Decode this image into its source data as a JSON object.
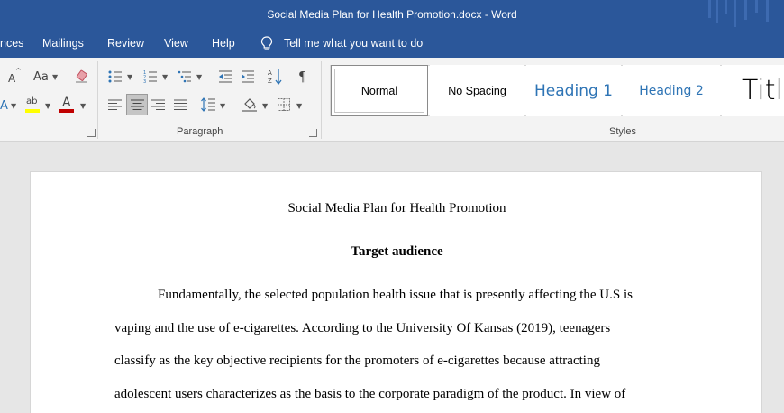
{
  "window": {
    "title": "Social Media Plan for Health Promotion.docx  -  Word"
  },
  "menu": {
    "items": [
      "nces",
      "Mailings",
      "Review",
      "View",
      "Help"
    ],
    "tell_me": "Tell me what you want to do"
  },
  "ribbon": {
    "font_group": {
      "grow_font": "A",
      "change_case": "Aa",
      "font_color_letter": "A",
      "highlight_text": "ab"
    },
    "paragraph_label": "Paragraph",
    "styles_label": "Styles",
    "styles": [
      {
        "label": "Normal",
        "selected": true
      },
      {
        "label": "No Spacing",
        "selected": false
      },
      {
        "label": "Heading 1",
        "selected": false
      },
      {
        "label": "Heading 2",
        "selected": false
      },
      {
        "label": "Title",
        "selected": false
      }
    ],
    "colors": {
      "highlight": "#ffff00",
      "font_color": "#c00000",
      "heading": "#2e74b5",
      "selected_align_bg": "#c5c5c5"
    },
    "icons": [
      "bullets-icon",
      "numbering-icon",
      "multilevel-list-icon",
      "decrease-indent-icon",
      "increase-indent-icon",
      "sort-icon",
      "show-formatting-icon",
      "align-left-icon",
      "align-center-icon",
      "align-right-icon",
      "justify-icon",
      "line-spacing-icon",
      "shading-icon",
      "borders-icon",
      "clear-formatting-icon"
    ]
  },
  "document": {
    "title": "Social Media Plan for Health Promotion",
    "heading": "Target audience",
    "lines": [
      "Fundamentally, the selected population health issue that is presently affecting the U.S is",
      "vaping and the use of e-cigarettes. According to the University Of Kansas (2019), teenagers",
      "classify as the key objective recipients for the promoters of e-cigarettes because attracting",
      "adolescent users characterizes as the basis to the corporate paradigm of the product. In view of"
    ]
  }
}
